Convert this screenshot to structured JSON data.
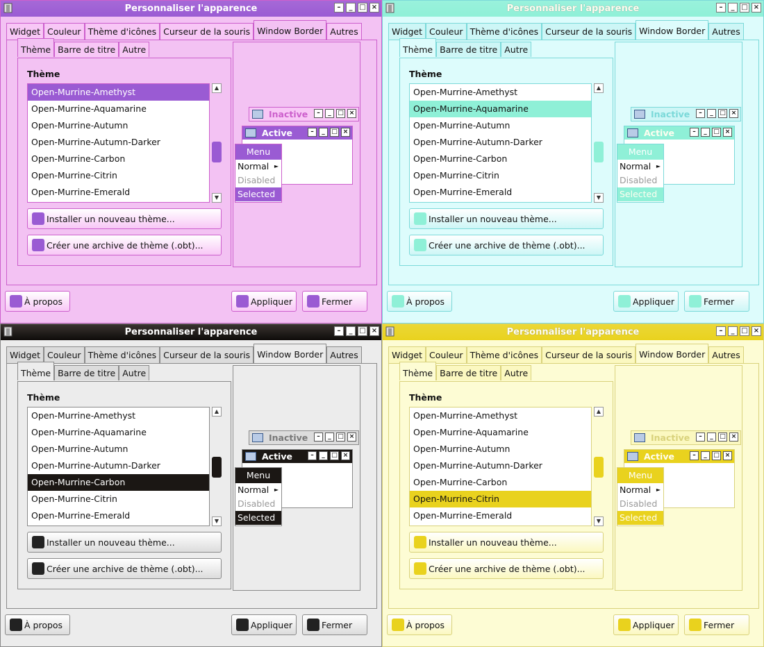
{
  "dialog": {
    "title": "Personnaliser l'apparence",
    "tabs": [
      "Widget",
      "Couleur",
      "Thème d'icônes",
      "Curseur de la souris",
      "Window Border",
      "Autres"
    ],
    "active_tab": "Window Border",
    "subtabs": [
      "Thème",
      "Barre de titre",
      "Autre"
    ],
    "section_label": "Thème",
    "themes": [
      "Open-Murrine-Amethyst",
      "Open-Murrine-Aquamarine",
      "Open-Murrine-Autumn",
      "Open-Murrine-Autumn-Darker",
      "Open-Murrine-Carbon",
      "Open-Murrine-Citrin",
      "Open-Murrine-Emerald"
    ],
    "install_button": "Installer un nouveau thème...",
    "archive_button": "Créer une archive de thème (.obt)...",
    "about_button": "À propos",
    "apply_button": "Appliquer",
    "close_button": "Fermer",
    "preview": {
      "inactive_label": "Inactive",
      "active_label": "Active",
      "menu_label": "Menu",
      "menu_items": [
        "Normal",
        "Disabled",
        "Selected"
      ]
    }
  },
  "variants": [
    {
      "name": "amethyst",
      "selected_theme": "Open-Murrine-Amethyst",
      "accent": "#9a5bd3",
      "bg": "#f3c2f3",
      "tab_bg": "#f8c7f6",
      "border": "#cc5fcc"
    },
    {
      "name": "aquamarine",
      "selected_theme": "Open-Murrine-Aquamarine",
      "accent": "#8ff0d7",
      "bg": "#ddfcfc",
      "tab_bg": "#cdf6f6",
      "border": "#7bd9d9"
    },
    {
      "name": "carbon",
      "selected_theme": "Open-Murrine-Carbon",
      "accent": "#1b1714",
      "bg": "#ececec",
      "tab_bg": "#dcdcdc",
      "border": "#8a8a8a"
    },
    {
      "name": "citrin",
      "selected_theme": "Open-Murrine-Citrin",
      "accent": "#e9d21e",
      "bg": "#fdfcd4",
      "tab_bg": "#fbf8c0",
      "border": "#d9d27c"
    }
  ]
}
